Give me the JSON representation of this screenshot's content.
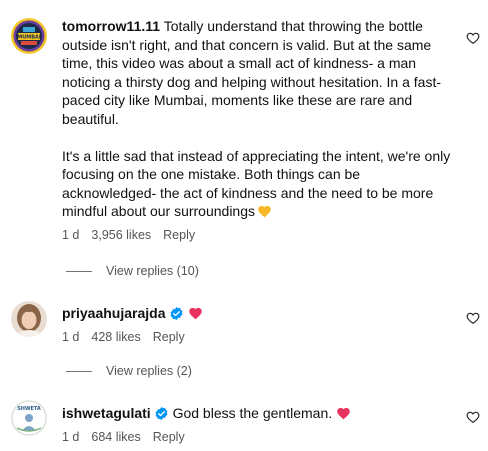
{
  "comments": [
    {
      "username": "tomorrow11.11",
      "verified": false,
      "paragraphs": [
        "Totally understand that throwing the bottle outside isn't right, and that concern is valid. But at the same time, this video was about a small act of kindness- a man noticing a thirsty dog and helping without hesitation. In a fast-paced city like Mumbai, moments like these are rare and beautiful.",
        "It's a little sad that instead of appreciating the intent, we're only focusing on the one mistake. Both things can be acknowledged- the act of kindness and the need to be more mindful about our surroundings"
      ],
      "emoji": "yellow-heart",
      "avatar_text": "MUMBAI",
      "time": "1 d",
      "likes": "3,956 likes",
      "reply_label": "Reply",
      "view_replies": "View replies (10)"
    },
    {
      "username": "priyaahujarajda",
      "verified": true,
      "text": "",
      "emoji": "red-heart",
      "time": "1 d",
      "likes": "428 likes",
      "reply_label": "Reply",
      "view_replies": "View replies (2)"
    },
    {
      "username": "ishwetagulati",
      "verified": true,
      "text": "God bless the gentleman.",
      "emoji": "red-heart",
      "avatar_text": "SHWETA",
      "time": "1 d",
      "likes": "684 likes",
      "reply_label": "Reply"
    }
  ],
  "colors": {
    "verified_blue": "#0095f6",
    "red_heart": "#e8335f",
    "yellow_heart": "#f7b928",
    "secondary_text": "#555555"
  }
}
